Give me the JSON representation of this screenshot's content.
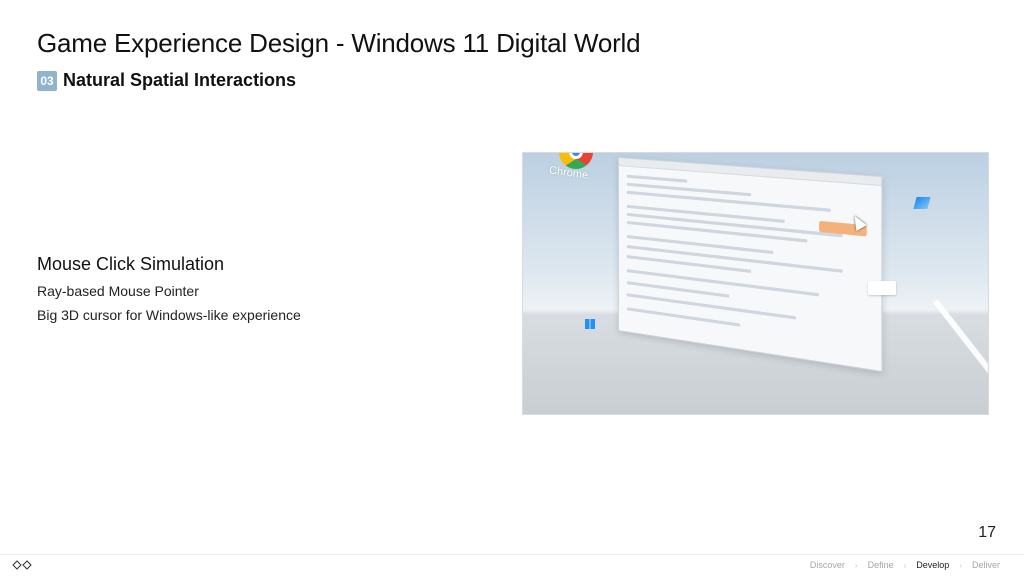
{
  "header": {
    "title": "Game Experience Design - Windows 11 Digital World",
    "section_number": "03",
    "section_title": "Natural Spatial Interactions"
  },
  "feature": {
    "title": "Mouse Click Simulation",
    "bullets": [
      "Ray-based Mouse Pointer",
      "Big 3D cursor for Windows-like experience"
    ]
  },
  "screenshot": {
    "desktop_icon_label": "Chrome"
  },
  "footer": {
    "page_number": "17",
    "nav": [
      {
        "label": "Discover",
        "active": false
      },
      {
        "label": "Define",
        "active": false
      },
      {
        "label": "Develop",
        "active": true
      },
      {
        "label": "Deliver",
        "active": false
      }
    ],
    "separator": "›"
  },
  "colors": {
    "badge": "#8fb4cb",
    "accent_button": "#f4b27a"
  }
}
